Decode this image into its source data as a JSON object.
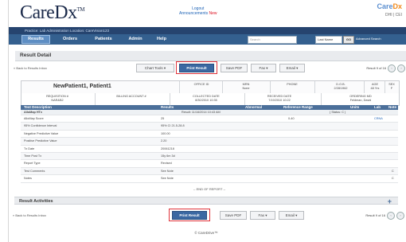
{
  "header": {
    "logo": "CareDx",
    "tm": "TM",
    "logout": "Logout",
    "announcements": "Announcements",
    "announcements_new": "New",
    "brand_a": "Care",
    "brand_b": "Dx",
    "brand_sub": "DHI | CEI"
  },
  "practice_bar": "Practice: Lab Administration   Location: CareVision123",
  "nav": {
    "tabs": [
      "Results",
      "Orders",
      "Patients",
      "Admin",
      "Help"
    ],
    "search_placeholder": "Search",
    "select_value": "Last Name",
    "go": "GO",
    "advanced": "Advanced Search"
  },
  "section_title": "Result Detail",
  "toolbar": {
    "back": "« Back to Results Inbox",
    "chart_tools": "Chart Tools ▾",
    "print": "Print Result",
    "save_pdf": "Save PDF",
    "fax": "Fax ▾",
    "email": "Email ▾",
    "result_of": "Result 9 of 16"
  },
  "patient": {
    "name": "NewPatient1, Patient1",
    "office_label": "OFFICE ID",
    "mrn_label": "MRN",
    "mrn_value": "None",
    "phone_label": "PHONE",
    "dob_label": "D.O.B.",
    "dob_value": "2/28/1962",
    "age_label": "AGE",
    "age_value": "48 Yrs",
    "sex_label": "SEX",
    "sex_value": "F",
    "req_label": "REQUISITION #",
    "req_value": "NAR&B2",
    "billing_label": "BILLING ACCOUNT #",
    "collected_label": "COLLECTED DATE",
    "collected_value": "8/30/2010 10:35",
    "received_label": "RECEIVED DATE",
    "received_value": "7/19/2010 10:22",
    "ordering_label": "ORDERING MD",
    "ordering_value": "Feldman, David"
  },
  "lab_header": [
    "Test Description",
    "Results",
    "Abnormal",
    "Reference Range",
    "Units",
    "Lab",
    "Note"
  ],
  "group_row": {
    "name": "AlloMap HTx",
    "result": "Result: 11/16/2014 10:43 AM",
    "status": "( Status: C )"
  },
  "rows": [
    {
      "desc": "AlloMap Score",
      "result": "25",
      "ref": "0-40",
      "lab": "CRNA",
      "note": ""
    },
    {
      "desc": "95% Confidence Interval",
      "result": "95% CI 21.5-28.8",
      "ref": "",
      "lab": "",
      "note": ""
    },
    {
      "desc": "Negative Predictive Value",
      "result": "100.00",
      "ref": "",
      "lab": "",
      "note": ""
    },
    {
      "desc": "Positive Predictive Value",
      "result": "2.20",
      "ref": "",
      "lab": "",
      "note": ""
    },
    {
      "desc": "Tx Date",
      "result": "20061218",
      "ref": "",
      "lab": "",
      "note": ""
    },
    {
      "desc": "Time Post Tx",
      "result": "15y 6m 3d",
      "ref": "",
      "lab": "",
      "note": ""
    },
    {
      "desc": "Report Type",
      "result": "Revised",
      "ref": "",
      "lab": "",
      "note": ""
    },
    {
      "desc": "Test Comments",
      "result": "See Note",
      "ref": "",
      "lab": "",
      "note": "C"
    },
    {
      "desc": "Notes",
      "result": "See Note",
      "ref": "",
      "lab": "",
      "note": "C"
    }
  ],
  "end_report": "-- END OF REPORT --",
  "activities_title": "Result Activities",
  "footer": "© CareDrive™"
}
